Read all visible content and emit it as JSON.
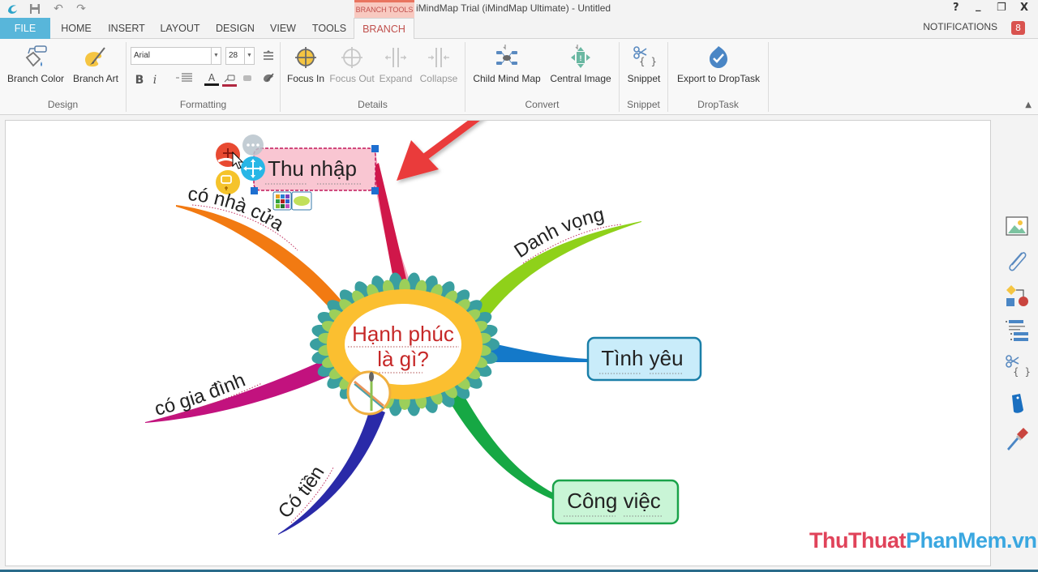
{
  "titlebar": {
    "title": "iMindMap Trial (iMindMap Ultimate) - Untitled",
    "context_tab_group": "BRANCH TOOLS",
    "help": "?",
    "minimize": "_",
    "restore": "❐",
    "close": "X"
  },
  "tabs": [
    {
      "label": "FILE"
    },
    {
      "label": "HOME"
    },
    {
      "label": "INSERT"
    },
    {
      "label": "LAYOUT"
    },
    {
      "label": "DESIGN"
    },
    {
      "label": "VIEW"
    },
    {
      "label": "TOOLS"
    },
    {
      "label": "BRANCH",
      "active": true
    }
  ],
  "notifications": {
    "label": "NOTIFICATIONS",
    "count": "8"
  },
  "ribbon": {
    "design": {
      "label": "Design",
      "branch_color": "Branch Color",
      "branch_art": "Branch Art"
    },
    "formatting": {
      "label": "Formatting",
      "font": "Arial",
      "size": "28",
      "bold": "B",
      "italic": "i",
      "font_color_glyph": "A",
      "font_color": "#1a1a1a",
      "branch_line_color": "#b0263f"
    },
    "details": {
      "label": "Details",
      "focus_in": "Focus In",
      "focus_out": "Focus Out",
      "expand": "Expand",
      "collapse": "Collapse"
    },
    "convert": {
      "label": "Convert",
      "child_mind_map": "Child Mind Map",
      "central_image": "Central Image"
    },
    "snippet": {
      "label": "Snippet",
      "snippet": "Snippet"
    },
    "droptask": {
      "label": "DropTask",
      "export": "Export to DropTask"
    }
  },
  "mindmap": {
    "central": {
      "line1": "Hạnh phúc",
      "line2": "là gì?",
      "text_color": "#c62828"
    },
    "branches": [
      {
        "id": "thu-nhap",
        "label": "Thu nhập",
        "color": "#d0174a",
        "boxed": true,
        "selected": true,
        "box_fill": "#f9c6d2"
      },
      {
        "id": "co-nha-cua",
        "label": "có nhà cửa",
        "color": "#f27a12",
        "boxed": false
      },
      {
        "id": "danh-vong",
        "label": "Danh vọng",
        "color": "#8fd11a",
        "boxed": false
      },
      {
        "id": "tinh-yeu",
        "label": "Tình yêu",
        "color": "#1479c9",
        "boxed": true,
        "box_fill": "#c9ecfa",
        "box_border": "#1a7fa8"
      },
      {
        "id": "co-gia-dinh",
        "label": "có gia đình",
        "color": "#c2127e",
        "boxed": false
      },
      {
        "id": "co-tien",
        "label": "Có tiền",
        "color": "#2a2aa8",
        "boxed": false
      },
      {
        "id": "cong-viec",
        "label": "Công việc",
        "color": "#16a844",
        "boxed": true,
        "box_fill": "#c9f5d6",
        "box_border": "#1aa34a"
      }
    ]
  },
  "annotation_arrow_color": "#ea3b3b",
  "watermark": {
    "part1": "ThuThuat",
    "part2": "PhanMem.vn"
  }
}
